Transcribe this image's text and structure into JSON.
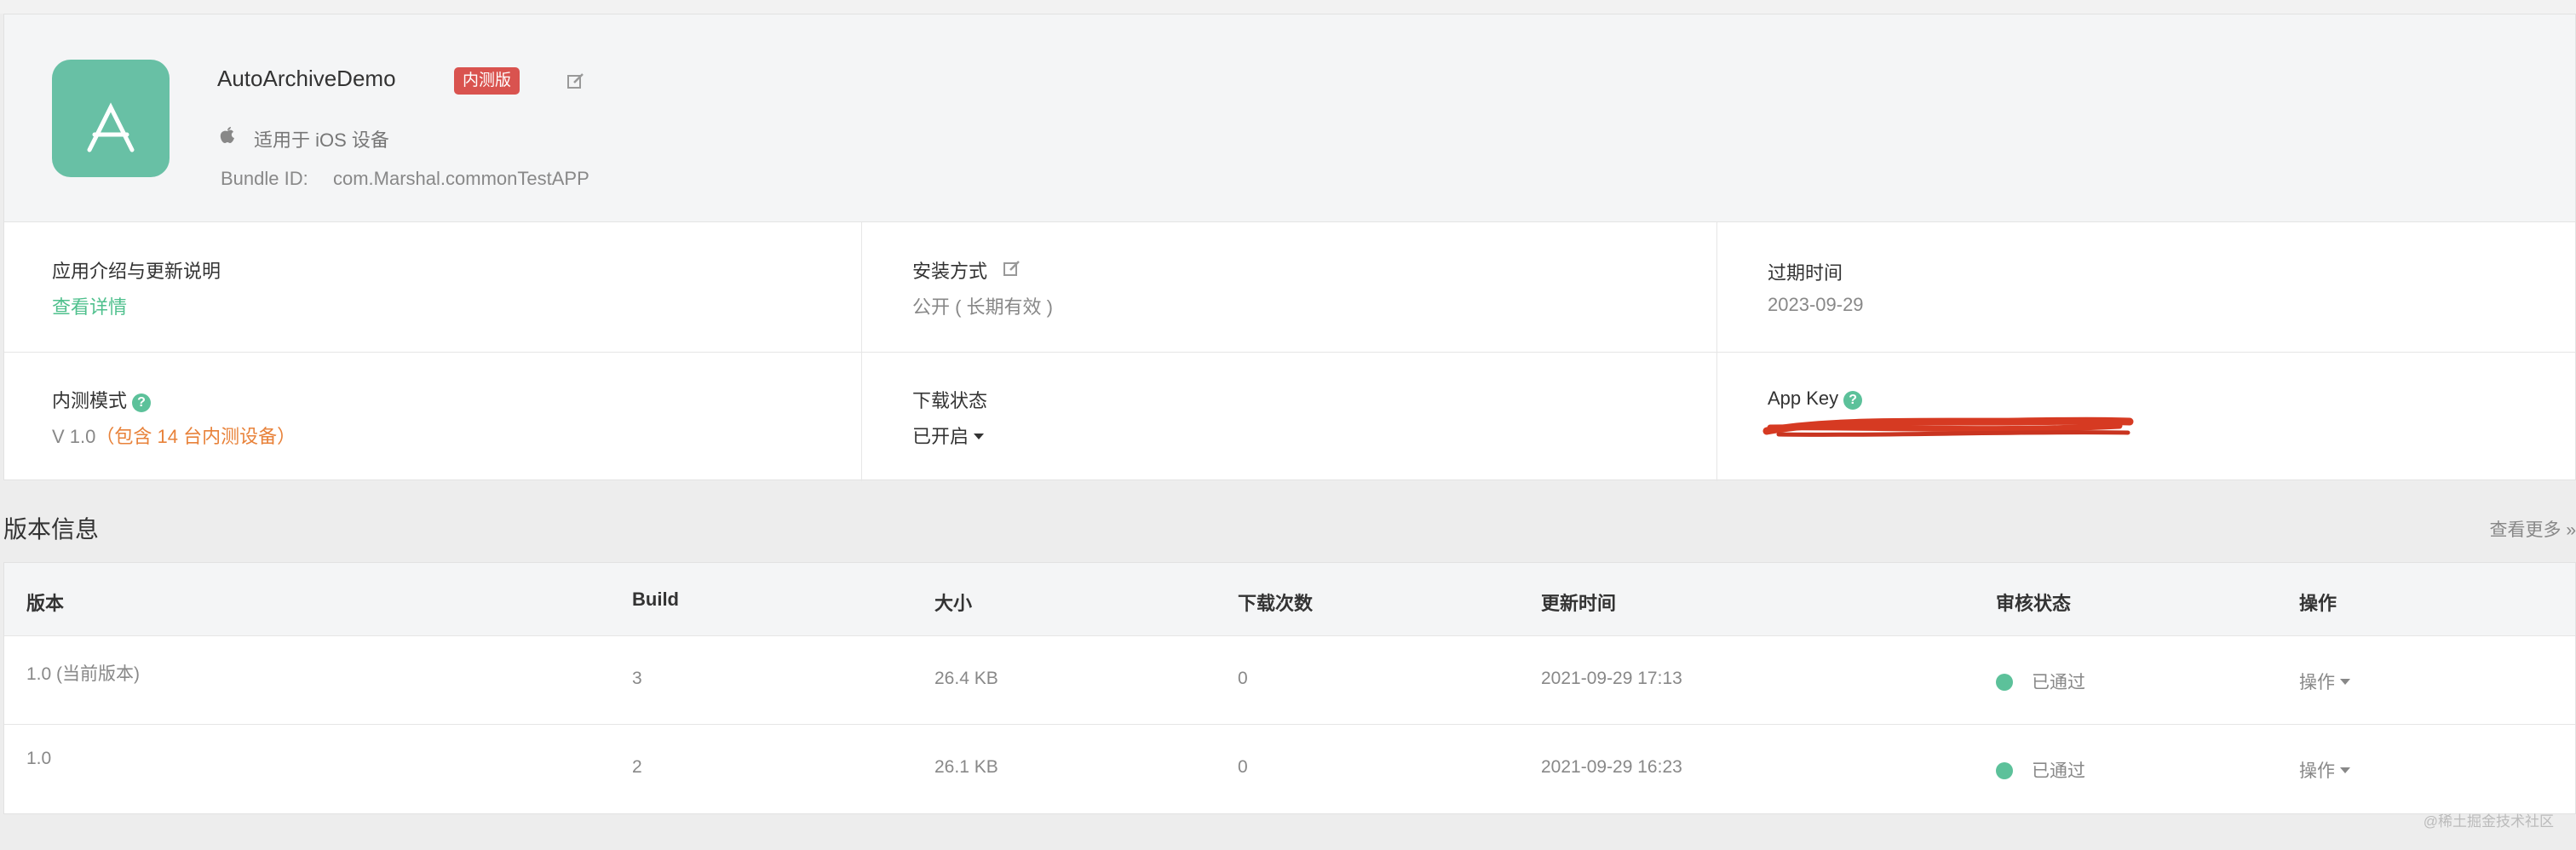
{
  "app": {
    "name": "AutoArchiveDemo",
    "badge": "内测版",
    "platform": "适用于 iOS 设备",
    "bundle_label": "Bundle ID:",
    "bundle_id": "com.Marshal.commonTestAPP",
    "icon_color": "#68c0a5"
  },
  "info": {
    "description_title": "应用介绍与更新说明",
    "description_link": "查看详情",
    "install_title": "安装方式",
    "install_value": "公开 ( 长期有效 )",
    "expire_title": "过期时间",
    "expire_value": "2023-09-29",
    "beta_mode_title": "内测模式",
    "beta_version": "V 1.0",
    "beta_devices": "（包含 14 台内测设备）",
    "download_title": "下载状态",
    "download_value": "已开启",
    "appkey_title": "App Key"
  },
  "versions": {
    "title": "版本信息",
    "more": "查看更多 »",
    "headers": [
      "版本",
      "Build",
      "大小",
      "下载次数",
      "更新时间",
      "审核状态",
      "操作"
    ],
    "rows": [
      [
        "1.0 (当前版本)",
        "3",
        "26.4 KB",
        "0",
        "2021-09-29 17:13",
        "已通过",
        "操作"
      ],
      [
        "1.0",
        "2",
        "26.1 KB",
        "0",
        "2021-09-29 16:23",
        "已通过",
        "操作"
      ]
    ]
  },
  "watermark": "@稀土掘金技术社区",
  "colors": {
    "accent_green": "#4fc08d",
    "badge_red": "#d9534f",
    "orange": "#e8823a",
    "redaction_red": "#d63a22"
  }
}
